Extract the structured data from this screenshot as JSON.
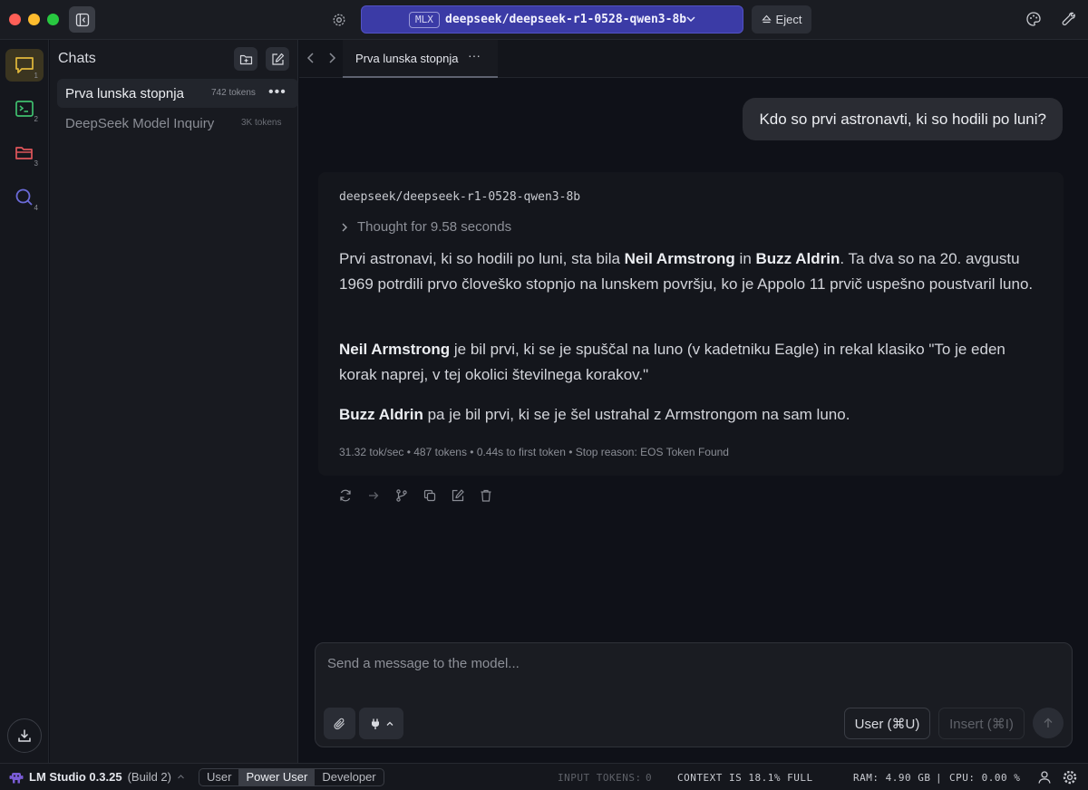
{
  "titlebar": {
    "model_badge": "MLX",
    "model_name": "deepseek/deepseek-r1-0528-qwen3-8b",
    "eject_label": "Eject"
  },
  "rail": {
    "items": [
      {
        "name": "chat",
        "num": "1"
      },
      {
        "name": "developer",
        "num": "2"
      },
      {
        "name": "my-models",
        "num": "3"
      },
      {
        "name": "discover",
        "num": "4"
      }
    ]
  },
  "chats": {
    "title": "Chats",
    "items": [
      {
        "name": "Prva lunska stopnja",
        "tokens": "742 tokens",
        "active": true
      },
      {
        "name": "DeepSeek Model Inquiry",
        "tokens": "3K tokens",
        "active": false
      }
    ]
  },
  "tab": {
    "label": "Prva lunska stopnja",
    "more": "···"
  },
  "conversation": {
    "user_message": "Kdo so prvi astronavti, ki so hodili po luni?",
    "assistant_model": "deepseek/deepseek-r1-0528-qwen3-8b",
    "thought": "Thought for 9.58 seconds",
    "p1": {
      "a": "Prvi astronavi, ki so hodili po luni, sta bila ",
      "b1": "Neil Armstrong",
      "c": " in ",
      "b2": "Buzz Aldrin",
      "d": ". Ta dva so na 20. avgustu 1969 potrdili prvo človeško stopnjo na lunskem površju, ko je Appolo 11 prvič uspešno poustvaril luno."
    },
    "p2": {
      "b": "Neil Armstrong",
      "rest": " je bil prvi, ki se je spuščal na luno (v kadetniku Eagle) in rekal klasiko \"To je eden korak naprej, v tej okolici številnega korakov.\""
    },
    "p3": {
      "b": "Buzz Aldrin",
      "rest": " pa je bil prvi, ki se je šel ustrahal z Armstrongom na sam luno."
    },
    "stats": "31.32 tok/sec • 487 tokens • 0.44s to first token • Stop reason: EOS Token Found"
  },
  "composer": {
    "placeholder": "Send a message to the model...",
    "user_button": "User (⌘U)",
    "insert_button": "Insert (⌘I)"
  },
  "statusbar": {
    "app_name": "LM Studio 0.3.25",
    "build": "(Build 2)",
    "modes": [
      "User",
      "Power User",
      "Developer"
    ],
    "active_mode": "Power User",
    "input_tokens_label": "INPUT TOKENS:",
    "input_tokens_value": "0",
    "context": "CONTEXT IS 18.1% FULL",
    "ram": "RAM: 4.90 GB",
    "separator": "|",
    "cpu": "CPU: 0.00 %"
  },
  "colors": {
    "accent": "#3b3ba6",
    "chat_icon": "#e2b93b",
    "terminal_icon": "#3fbf6f",
    "folder_icon": "#e0565b",
    "search_icon": "#6b6bd8"
  }
}
